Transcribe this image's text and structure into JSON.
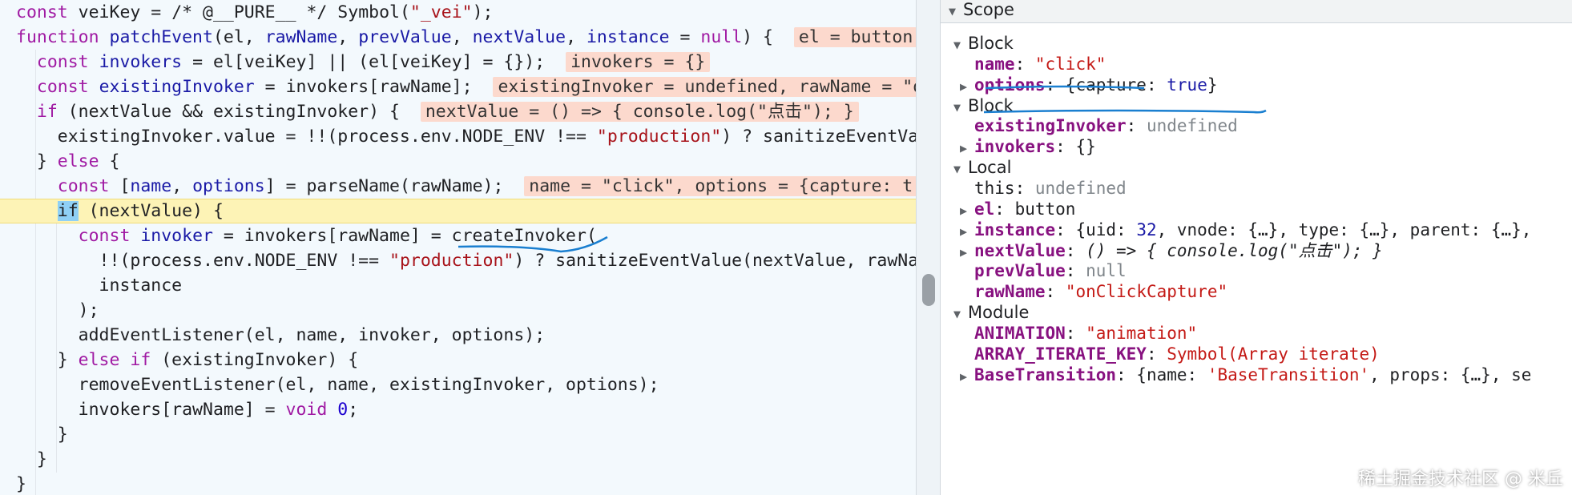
{
  "editor": {
    "lines": [
      [
        [
          "const ",
          "kw"
        ],
        [
          "veiKey",
          ""
        ],
        [
          " = ",
          ""
        ],
        [
          "/* @__PURE__ */",
          ""
        ],
        [
          " Symbol(",
          ""
        ],
        [
          "\"_vei\"",
          "str"
        ],
        [
          ");",
          ""
        ]
      ],
      [
        [
          "function ",
          "kw"
        ],
        [
          "patchEvent",
          "def"
        ],
        [
          "(",
          ""
        ],
        [
          "el",
          ""
        ],
        [
          ", ",
          ""
        ],
        [
          "rawName",
          "def"
        ],
        [
          ", ",
          ""
        ],
        [
          "prevValue",
          "def"
        ],
        [
          ", ",
          ""
        ],
        [
          "nextValue",
          "def"
        ],
        [
          ", ",
          ""
        ],
        [
          "instance",
          "def"
        ],
        [
          " = ",
          ""
        ],
        [
          "null",
          "kw"
        ],
        [
          ") {  ",
          ""
        ],
        [
          "el = button",
          "iv"
        ]
      ],
      [
        [
          "  const ",
          "kw"
        ],
        [
          "invokers",
          "def"
        ],
        [
          " = el[veiKey] || (el[veiKey] = {});  ",
          ""
        ],
        [
          "invokers = {}",
          "iv"
        ]
      ],
      [
        [
          "  const ",
          "kw"
        ],
        [
          "existingInvoker",
          "def"
        ],
        [
          " = invokers[rawName];  ",
          ""
        ],
        [
          "existingInvoker = undefined, rawName = \"o",
          "iv"
        ]
      ],
      [
        [
          "  if ",
          "kw"
        ],
        [
          "(nextValue && existingInvoker) {  ",
          ""
        ],
        [
          "nextValue = () => { console.log(\"点击\"); }",
          "iv"
        ]
      ],
      [
        [
          "    existingInvoker.value = !!(process.env.NODE_ENV !== ",
          ""
        ],
        [
          "\"production\"",
          "str"
        ],
        [
          ") ? sanitizeEventVa",
          ""
        ]
      ],
      [
        [
          "  } ",
          ""
        ],
        [
          "else",
          "kw"
        ],
        [
          " {",
          ""
        ]
      ],
      [
        [
          "    const ",
          "kw"
        ],
        [
          "[",
          ""
        ],
        [
          "name",
          "def"
        ],
        [
          ", ",
          ""
        ],
        [
          "options",
          "def"
        ],
        [
          "] = parseName(rawName);  ",
          ""
        ],
        [
          "name = \"click\", options = {capture: tr",
          "iv"
        ]
      ],
      [
        [
          "    ",
          ""
        ],
        [
          "if",
          "cur"
        ],
        [
          " (nextValue) {",
          ""
        ]
      ],
      [
        [
          "      const ",
          "kw"
        ],
        [
          "invoker",
          "def"
        ],
        [
          " = invokers[rawName] = createInvoker(",
          ""
        ]
      ],
      [
        [
          "        !!(process.env.NODE_ENV !== ",
          ""
        ],
        [
          "\"production\"",
          "str"
        ],
        [
          ") ? sanitizeEventValue(nextValue, rawNa",
          ""
        ]
      ],
      [
        [
          "        instance",
          ""
        ]
      ],
      [
        [
          "      );",
          ""
        ]
      ],
      [
        [
          "      addEventListener(el, name, invoker, options);",
          ""
        ]
      ],
      [
        [
          "    } ",
          ""
        ],
        [
          "else if",
          "kw"
        ],
        [
          " (existingInvoker) {",
          ""
        ]
      ],
      [
        [
          "      removeEventListener(el, name, existingInvoker, options);",
          ""
        ]
      ],
      [
        [
          "      invokers[rawName] = ",
          ""
        ],
        [
          "void ",
          "kw"
        ],
        [
          "0",
          "num"
        ],
        [
          ";",
          ""
        ]
      ],
      [
        [
          "    }",
          ""
        ]
      ],
      [
        [
          "  }",
          ""
        ]
      ],
      [
        [
          "}",
          ""
        ]
      ]
    ]
  },
  "scope": {
    "title": "Scope",
    "rows": [
      {
        "tri": "▼",
        "indent": 1,
        "parts": [
          [
            "Block",
            "sec"
          ]
        ]
      },
      {
        "tri": "",
        "indent": 2,
        "parts": [
          [
            "name",
            "key"
          ],
          [
            ": ",
            ""
          ],
          [
            "\"click\"",
            "pval-str"
          ]
        ]
      },
      {
        "tri": "▶",
        "indent": 2,
        "parts": [
          [
            "options",
            "key"
          ],
          [
            ": {",
            ""
          ],
          [
            "capture",
            ""
          ],
          [
            ": ",
            ""
          ],
          [
            "true",
            "pval-num"
          ],
          [
            "}",
            ""
          ]
        ]
      },
      {
        "tri": "▼",
        "indent": 1,
        "parts": [
          [
            "Block",
            "sec"
          ]
        ]
      },
      {
        "tri": "",
        "indent": 2,
        "parts": [
          [
            "existingInvoker",
            "key"
          ],
          [
            ": ",
            ""
          ],
          [
            "undefined",
            "pval-gray"
          ]
        ]
      },
      {
        "tri": "▶",
        "indent": 2,
        "parts": [
          [
            "invokers",
            "key"
          ],
          [
            ": {}",
            ""
          ]
        ]
      },
      {
        "tri": "▼",
        "indent": 1,
        "parts": [
          [
            "Local",
            "sec"
          ]
        ]
      },
      {
        "tri": "",
        "indent": 2,
        "parts": [
          [
            "this",
            ""
          ],
          [
            ": ",
            ""
          ],
          [
            "undefined",
            "pval-gray"
          ]
        ]
      },
      {
        "tri": "▶",
        "indent": 2,
        "parts": [
          [
            "el",
            "key"
          ],
          [
            ": button",
            ""
          ]
        ]
      },
      {
        "tri": "▶",
        "indent": 2,
        "parts": [
          [
            "instance",
            "key"
          ],
          [
            ": {uid: ",
            ""
          ],
          [
            "32",
            "pval-num"
          ],
          [
            ", vnode: {…}, type: {…}, parent: {…},",
            ""
          ]
        ]
      },
      {
        "tri": "▶",
        "indent": 2,
        "parts": [
          [
            "nextValue",
            "key"
          ],
          [
            ": ",
            ""
          ],
          [
            "() => { console.log(\"点击\"); }",
            "pval-fn"
          ]
        ]
      },
      {
        "tri": "",
        "indent": 2,
        "parts": [
          [
            "prevValue",
            "key"
          ],
          [
            ": ",
            ""
          ],
          [
            "null",
            "pval-gray"
          ]
        ]
      },
      {
        "tri": "",
        "indent": 2,
        "parts": [
          [
            "rawName",
            "key"
          ],
          [
            ": ",
            ""
          ],
          [
            "\"onClickCapture\"",
            "pval-str"
          ]
        ]
      },
      {
        "tri": "▼",
        "indent": 1,
        "parts": [
          [
            "Module",
            "sec"
          ]
        ]
      },
      {
        "tri": "",
        "indent": 2,
        "parts": [
          [
            "ANIMATION",
            "key"
          ],
          [
            ": ",
            ""
          ],
          [
            "\"animation\"",
            "pval-str"
          ]
        ]
      },
      {
        "tri": "",
        "indent": 2,
        "parts": [
          [
            "ARRAY_ITERATE_KEY",
            "key"
          ],
          [
            ": ",
            ""
          ],
          [
            "Symbol(Array iterate)",
            "pval-str"
          ]
        ]
      },
      {
        "tri": "▶",
        "indent": 2,
        "parts": [
          [
            "BaseTransition",
            "key"
          ],
          [
            ": {name: ",
            ""
          ],
          [
            "'BaseTransition'",
            "pval-str"
          ],
          [
            ", props: {…}, se",
            ""
          ]
        ]
      }
    ]
  },
  "watermark": "稀土掘金技术社区 @ 米丘",
  "colors": {
    "annotation": "#1a7fd0",
    "highlight": "#fdf3b6",
    "inline_value": "#fcd9cd"
  }
}
